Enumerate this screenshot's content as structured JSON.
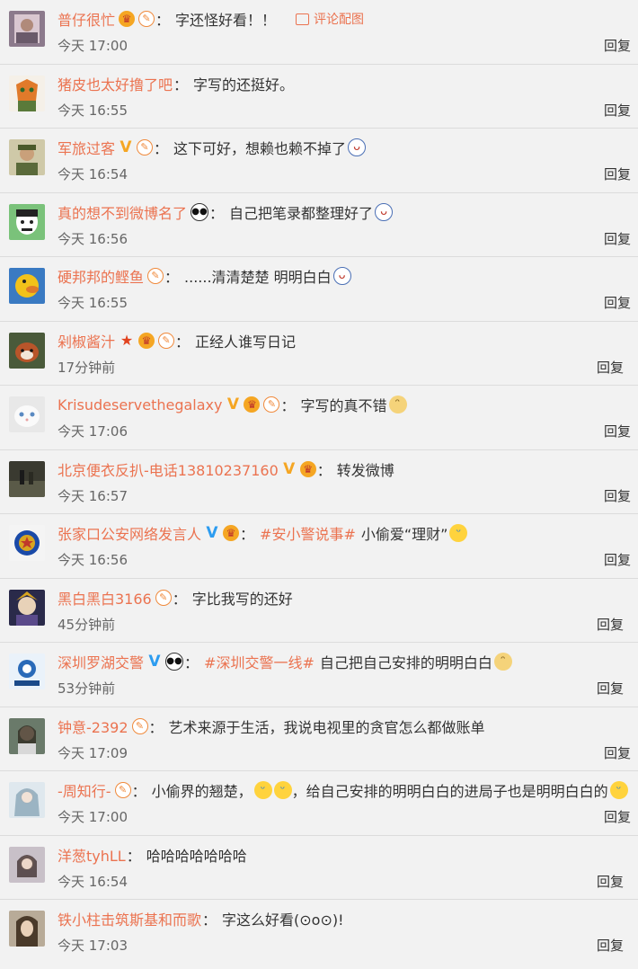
{
  "reply_label": "回复",
  "pic_comment_label": "评论配图",
  "colors": {
    "name": "#eb7350",
    "time": "#666666",
    "divider": "#dcdcdc",
    "background": "#f2f2f2"
  },
  "comments": [
    {
      "name": "普仔很忙",
      "badges": [
        "crown",
        "fan"
      ],
      "text": "字还怪好看！！",
      "time": "今天 17:00",
      "avatar": "portrait-icon"
    },
    {
      "name": "猪皮也太好撸了吧",
      "badges": [],
      "text": "字写的还挺好。",
      "time": "今天 16:55",
      "avatar": "fox-cartoon-icon"
    },
    {
      "name": "军旅过客",
      "badges": [
        "v-gold",
        "fan"
      ],
      "text": "这下可好，想赖也赖不掉了",
      "emoji": "tongue-face-icon",
      "time": "今天 16:54",
      "avatar": "soldier-icon"
    },
    {
      "name": "真的想不到微博名了",
      "badges": [
        "panda"
      ],
      "text": "自己把笔录都整理好了",
      "emoji": "tongue-face-icon",
      "time": "今天 16:56",
      "avatar": "cartoon-face-icon"
    },
    {
      "name": "硬邦邦的鲣鱼",
      "badges": [
        "fan"
      ],
      "text": "......清清楚楚 明明白白",
      "emoji": "tongue-face-icon",
      "time": "今天 16:55",
      "avatar": "duck-icon"
    },
    {
      "name": "剁椒酱汁",
      "badges": [
        "star",
        "crown",
        "fan"
      ],
      "text": "正经人谁写日记",
      "time": "17分钟前",
      "avatar": "red-panda-icon"
    },
    {
      "name": "Krisudeservethegalaxy",
      "badges": [
        "v-gold",
        "crown",
        "fan"
      ],
      "text": "字写的真不错",
      "emoji": "doge-icon",
      "time": "今天 17:06",
      "avatar": "white-cat-icon"
    },
    {
      "name": "北京便衣反扒-电话13810237160",
      "badges": [
        "v-gold",
        "crown"
      ],
      "text": "转发微博",
      "time": "今天 16:57",
      "avatar": "street-photo-icon"
    },
    {
      "name": "张家口公安网络发言人",
      "badges": [
        "v-blue",
        "crown"
      ],
      "topic": "#安小警说事#",
      "text": "小偷爱“理财”",
      "emoji": "laugh-cry-icon",
      "time": "今天 16:56",
      "avatar": "police-emblem-icon"
    },
    {
      "name": "黑白黑白3166",
      "badges": [
        "fan"
      ],
      "text": "字比我写的还好",
      "time": "45分钟前",
      "avatar": "anime-character-icon"
    },
    {
      "name": "深圳罗湖交警",
      "badges": [
        "v-blue",
        "panda"
      ],
      "topic": "#深圳交警一线#",
      "text": "自己把自己安排的明明白白",
      "emoji": "doge-icon",
      "time": "53分钟前",
      "avatar": "traffic-police-icon"
    },
    {
      "name": "钟意-2392",
      "badges": [
        "fan"
      ],
      "text": "艺术来源于生活，我说电视里的贪官怎么都做账单",
      "time": "今天 17:09",
      "avatar": "girl-photo-icon"
    },
    {
      "name": "-周知行-",
      "badges": [
        "fan"
      ],
      "text": "小偷界的翘楚，",
      "emoji_pair": [
        "laugh-cry-icon",
        "laugh-cry-icon"
      ],
      "text2": "，给自己安排的明明白白的进局子也是明明白白的",
      "emoji_tail": "laugh-cry-icon",
      "time": "今天 17:00",
      "avatar": "anime-girl-icon"
    },
    {
      "name": "洋葱tyhLL",
      "badges": [],
      "text": "哈哈哈哈哈哈哈",
      "time": "今天 16:54",
      "avatar": "girl-selfie-icon"
    },
    {
      "name": "铁小柱击筑斯基和而歌",
      "badges": [],
      "text": "字这么好看(⊙o⊙)!",
      "time": "今天 17:03",
      "avatar": "woman-portrait-icon"
    }
  ]
}
